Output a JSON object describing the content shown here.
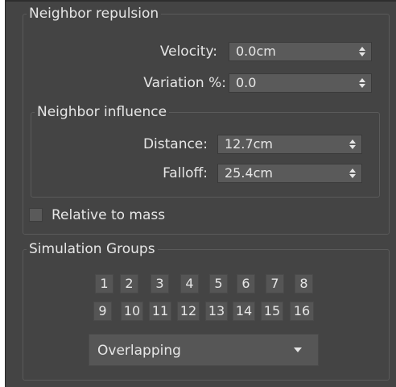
{
  "neighbor_repulsion": {
    "title": "Neighbor repulsion",
    "velocity": {
      "label": "Velocity:",
      "value": "0.0cm"
    },
    "variation": {
      "label": "Variation %:",
      "value": "0.0"
    },
    "neighbor_influence": {
      "title": "Neighbor influence",
      "distance": {
        "label": "Distance:",
        "value": "12.7cm"
      },
      "falloff": {
        "label": "Falloff:",
        "value": "25.4cm"
      }
    },
    "relative_to_mass": {
      "label": "Relative to mass",
      "checked": false
    }
  },
  "simulation_groups": {
    "title": "Simulation Groups",
    "row1": [
      "1",
      "2",
      "3",
      "4",
      "5",
      "6",
      "7",
      "8"
    ],
    "row2": [
      "9",
      "10",
      "11",
      "12",
      "13",
      "14",
      "15",
      "16"
    ],
    "dropdown_value": "Overlapping"
  }
}
